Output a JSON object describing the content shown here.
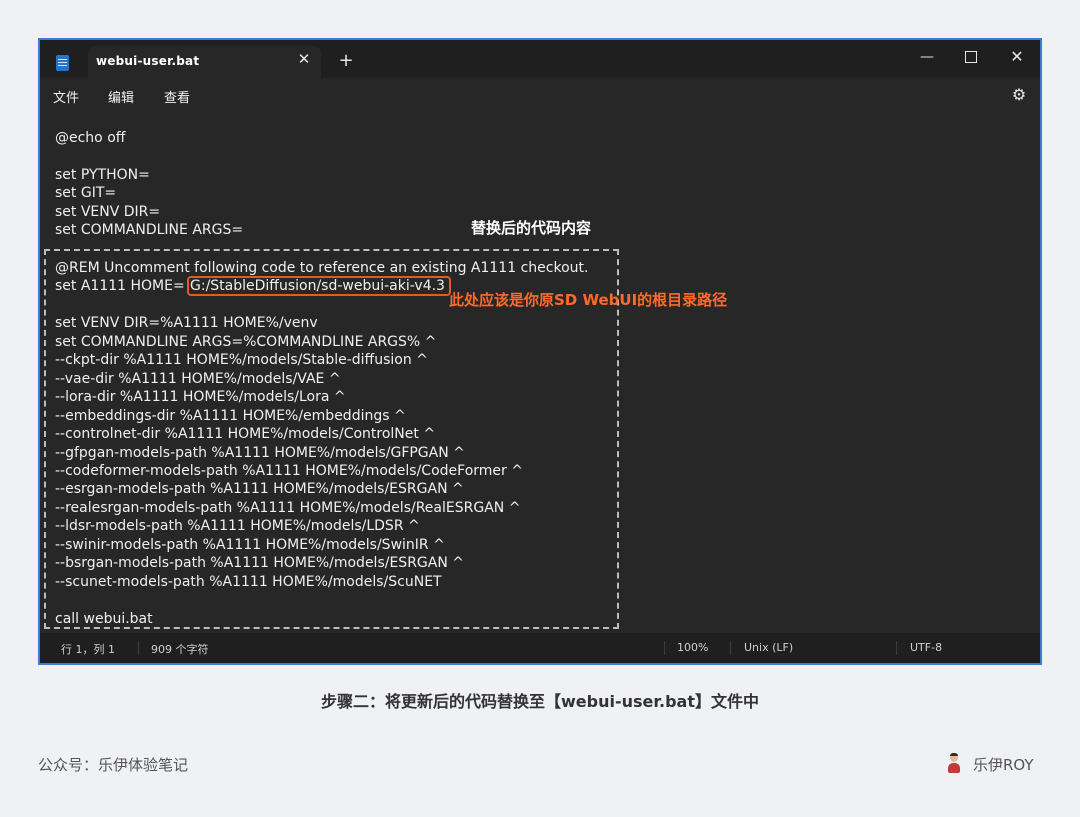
{
  "window": {
    "tab_title": "webui-user.bat",
    "tab_close": "✕",
    "new_tab": "+",
    "minimize": "—",
    "close": "✕"
  },
  "menu": {
    "file": "文件",
    "edit": "编辑",
    "view": "查看",
    "settings_icon": "⚙"
  },
  "editor": {
    "lines_top": [
      "@echo off",
      "",
      "set PYTHON=",
      "set GIT=",
      "set VENV DIR=",
      "set COMMANDLINE ARGS="
    ],
    "lines_box": [
      "@REM Uncomment following code to reference an existing A1111 checkout.",
      "set A1111 HOME=",
      "",
      "set VENV DIR=%A1111 HOME%/venv",
      "set COMMANDLINE ARGS=%COMMANDLINE ARGS% ^",
      "--ckpt-dir %A1111 HOME%/models/Stable-diffusion ^",
      "--vae-dir %A1111 HOME%/models/VAE ^",
      "--lora-dir %A1111 HOME%/models/Lora ^",
      "--embeddings-dir %A1111 HOME%/embeddings ^",
      "--controlnet-dir %A1111 HOME%/models/ControlNet ^",
      "--gfpgan-models-path %A1111 HOME%/models/GFPGAN ^",
      "--codeformer-models-path %A1111 HOME%/models/CodeFormer ^",
      "--esrgan-models-path %A1111 HOME%/models/ESRGAN ^",
      "--realesrgan-models-path %A1111 HOME%/models/RealESRGAN ^",
      "--ldsr-models-path %A1111 HOME%/models/LDSR ^",
      "--swinir-models-path %A1111 HOME%/models/SwinIR ^",
      "--bsrgan-models-path %A1111 HOME%/models/ESRGAN ^",
      "--scunet-models-path %A1111 HOME%/models/ScuNET",
      "",
      "call webui.bat"
    ],
    "highlighted_path": "G:/StableDiffusion/sd-webui-aki-v4.3",
    "annotation_replaced": "替换后的代码内容",
    "annotation_path": "此处应该是你原SD WebUI的根目录路径"
  },
  "status": {
    "position": "行 1，列 1",
    "char_count": "909 个字符",
    "zoom": "100%",
    "line_ending": "Unix (LF)",
    "encoding": "UTF-8"
  },
  "caption": "步骤二：将更新后的代码替换至【webui-user.bat】文件中",
  "footer": {
    "left": "公众号：乐伊体验笔记",
    "right": "乐伊ROY"
  }
}
